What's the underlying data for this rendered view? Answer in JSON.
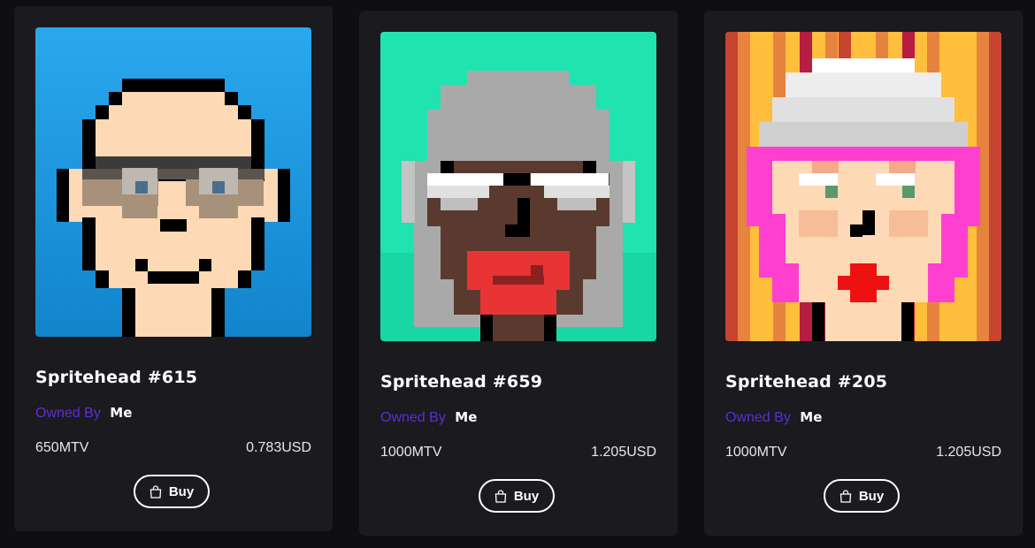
{
  "cards": [
    {
      "title": "Spritehead #615",
      "owned_label": "Owned By",
      "owner": "Me",
      "price": "650MTV",
      "usd": "0.783USD",
      "buy_label": "Buy",
      "background": "#1f9be0"
    },
    {
      "title": "Spritehead #659",
      "owned_label": "Owned By",
      "owner": "Me",
      "price": "1000MTV",
      "usd": "1.205USD",
      "buy_label": "Buy",
      "background": "#20e3b0"
    },
    {
      "title": "Spritehead #205",
      "owned_label": "Owned By",
      "owner": "Me",
      "price": "1000MTV",
      "usd": "1.205USD",
      "buy_label": "Buy",
      "background": "#e5833f"
    }
  ],
  "icons": {
    "buy": "shopping-bag-icon"
  },
  "colors": {
    "owned_label": "#5b2fd6",
    "card": "#1b1a1f",
    "page": "#0f0f12"
  }
}
